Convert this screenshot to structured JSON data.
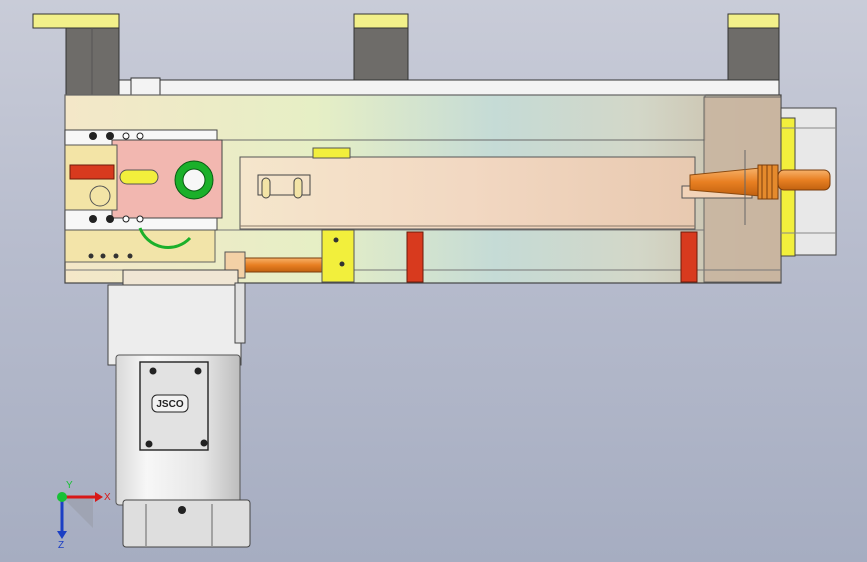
{
  "motor": {
    "brand_label": "JSCO"
  },
  "triad": {
    "x_label": "X",
    "y_label": "Y",
    "z_label": "Z"
  },
  "colors": {
    "background_top": "#c9ccd8",
    "background_bottom": "#a6adc1",
    "mount_yellow": "#f2f08a",
    "bracket_gray": "#6e6c69",
    "orange_part": "#f08a2a",
    "red_part": "#d83a1e",
    "green_gear": "#1bb02a",
    "pink_plate": "#f2b7b0",
    "motor_body": "#ececec"
  }
}
